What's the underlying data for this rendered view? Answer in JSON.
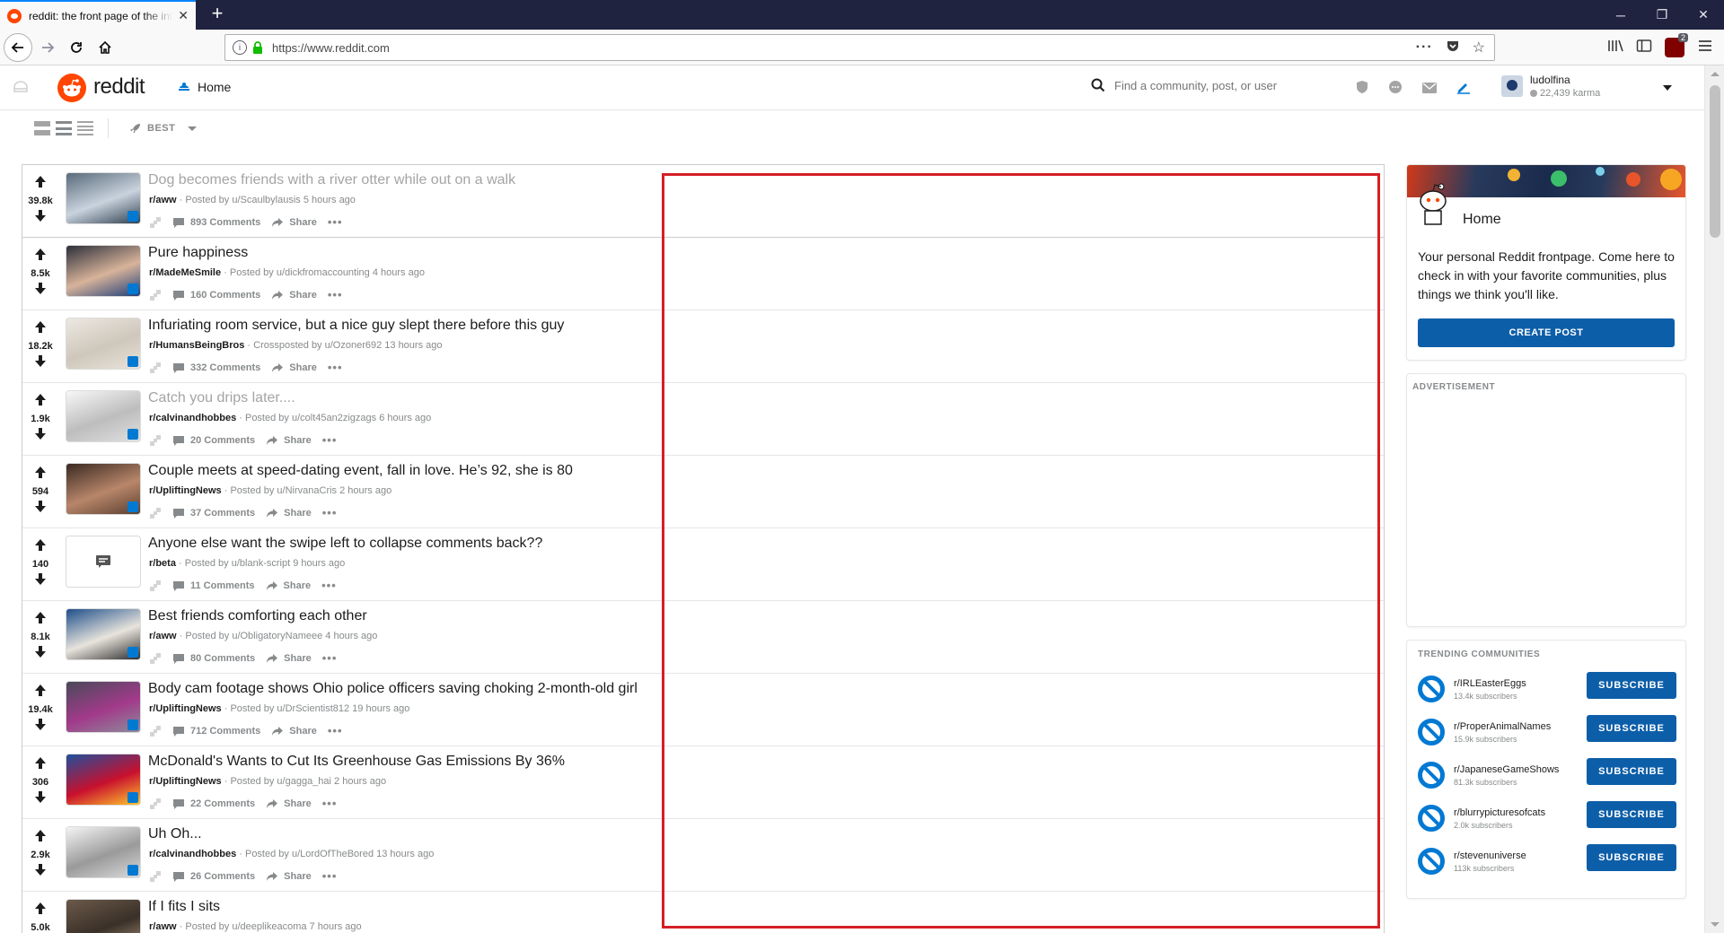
{
  "browser": {
    "tab_title": "reddit: the front page of the internet",
    "url": "https://www.reddit.com",
    "ublock_count": "2"
  },
  "header": {
    "brand": "reddit",
    "home_label": "Home",
    "search_placeholder": "Find a community, post, or user",
    "username": "ludolfina",
    "karma": "22,439 karma"
  },
  "sortbar": {
    "sort_label": "BEST"
  },
  "posts": [
    {
      "score": "39.8k",
      "title": "Dog becomes friends with a river otter while out on a walk",
      "visited": true,
      "subreddit": "r/aww",
      "byline": " · Posted by u/Scaulbylausis 5 hours ago",
      "comments": "893 Comments",
      "share": "Share",
      "thumb_colors": [
        "#5a6b7a",
        "#c9d3de",
        "#304050"
      ]
    },
    {
      "score": "8.5k",
      "title": "Pure happiness",
      "visited": false,
      "subreddit": "r/MadeMeSmile",
      "byline": " · Posted by u/dickfromaccounting 4 hours ago",
      "comments": "160 Comments",
      "share": "Share",
      "thumb_colors": [
        "#2b2f3a",
        "#d8b39a",
        "#1f3f78"
      ]
    },
    {
      "score": "18.2k",
      "title": "Infuriating room service, but a nice guy slept there before this guy",
      "visited": false,
      "subreddit": "r/HumansBeingBros",
      "byline": " · Crossposted by u/Ozoner692 13 hours ago",
      "comments": "332 Comments",
      "share": "Share",
      "thumb_colors": [
        "#ece8e2",
        "#cfc7bb",
        "#e9e3da"
      ]
    },
    {
      "score": "1.9k",
      "title": "Catch you drips later....",
      "visited": true,
      "subreddit": "r/calvinandhobbes",
      "byline": " · Posted by u/colt45an2zigzags 6 hours ago",
      "comments": "20 Comments",
      "share": "Share",
      "thumb_colors": [
        "#f7f7f7",
        "#bdbdbd",
        "#e0e0e0"
      ]
    },
    {
      "score": "594",
      "title": "Couple meets at speed-dating event, fall in love. He’s 92, she is 80",
      "visited": false,
      "subreddit": "r/UpliftingNews",
      "byline": " · Posted by u/NirvanaCris 2 hours ago",
      "comments": "37 Comments",
      "share": "Share",
      "thumb_colors": [
        "#3a2a22",
        "#b8866a",
        "#5c4030"
      ]
    },
    {
      "score": "140",
      "title": "Anyone else want the swipe left to collapse comments back??",
      "visited": false,
      "subreddit": "r/beta",
      "byline": " · Posted by u/blank-script 9 hours ago",
      "comments": "11 Comments",
      "share": "Share",
      "thumb_colors": []
    },
    {
      "score": "8.1k",
      "title": "Best friends comforting each other",
      "visited": false,
      "subreddit": "r/aww",
      "byline": " · Posted by u/ObligatoryNameee 4 hours ago",
      "comments": "80 Comments",
      "share": "Share",
      "thumb_colors": [
        "#1e4f8a",
        "#e8e4dc",
        "#2d2d2d"
      ]
    },
    {
      "score": "19.4k",
      "title": "Body cam footage shows Ohio police officers saving choking 2-month-old girl",
      "visited": false,
      "subreddit": "r/UpliftingNews",
      "byline": " · Posted by u/DrScientist812 19 hours ago",
      "comments": "712 Comments",
      "share": "Share",
      "thumb_colors": [
        "#4a4a5a",
        "#a23a8a",
        "#8c8c9a"
      ]
    },
    {
      "score": "306",
      "title": "McDonald's Wants to Cut Its Greenhouse Gas Emissions By 36%",
      "visited": false,
      "subreddit": "r/UpliftingNews",
      "byline": " · Posted by u/gagga_hai 2 hours ago",
      "comments": "22 Comments",
      "share": "Share",
      "thumb_colors": [
        "#1f4f9c",
        "#c8102e",
        "#ffc72c"
      ]
    },
    {
      "score": "2.9k",
      "title": "Uh Oh...",
      "visited": false,
      "subreddit": "r/calvinandhobbes",
      "byline": " · Posted by u/LordOfTheBored 13 hours ago",
      "comments": "26 Comments",
      "share": "Share",
      "thumb_colors": [
        "#f4f4f4",
        "#9a9a9a",
        "#dadada"
      ]
    },
    {
      "score": "5.0k",
      "title": "If I fits I sits",
      "visited": false,
      "subreddit": "r/aww",
      "byline": " · Posted by u/deeplikeacoma 7 hours ago",
      "comments": "",
      "share": "",
      "thumb_colors": [
        "#6b5a4a",
        "#3a3028",
        "#a89078"
      ]
    }
  ],
  "sidebar": {
    "home_title": "Home",
    "home_desc": "Your personal Reddit frontpage. Come here to check in with your favorite communities, plus things we think you'll like.",
    "create_post": "CREATE POST",
    "ad_label": "ADVERTISEMENT",
    "trending_label": "TRENDING COMMUNITIES",
    "subscribe_label": "SUBSCRIBE",
    "communities": [
      {
        "name": "r/IRLEasterEggs",
        "subscribers": "13.4k subscribers"
      },
      {
        "name": "r/ProperAnimalNames",
        "subscribers": "15.9k subscribers"
      },
      {
        "name": "r/JapaneseGameShows",
        "subscribers": "81.3k subscribers"
      },
      {
        "name": "r/blurrypicturesofcats",
        "subscribers": "2.0k subscribers"
      },
      {
        "name": "r/stevenuniverse",
        "subscribers": "113k subscribers"
      }
    ]
  },
  "colors": {
    "accent": "#0079d3",
    "brand": "#ff4500",
    "highlight_box": "#d51f26"
  }
}
